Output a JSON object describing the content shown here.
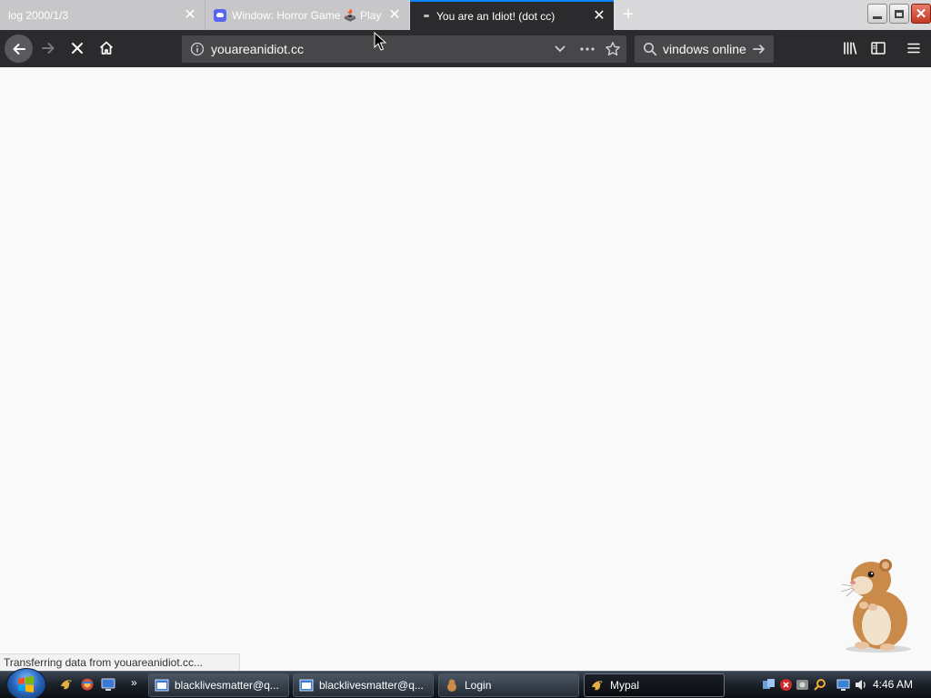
{
  "tabs": [
    {
      "title": "log 2000/1/3",
      "active": false
    },
    {
      "title": "Window: Horror Game 🕹️ Play",
      "active": false
    },
    {
      "title": "You are an Idiot! (dot cc)",
      "active": true
    }
  ],
  "toolbar": {
    "url": "youareanidiot.cc",
    "search_query": "vindows online"
  },
  "status_text": "Transferring data from youareanidiot.cc...",
  "taskbar": {
    "tasks": [
      {
        "label": "blacklivesmatter@q...",
        "active": false
      },
      {
        "label": "blacklivesmatter@q...",
        "active": false
      },
      {
        "label": "Login",
        "active": false
      },
      {
        "label": "Mypal",
        "active": true
      }
    ],
    "clock": "4:46 AM"
  },
  "colors": {
    "accent": "#0a84ff",
    "toolbar_dark": "#2b2b2e",
    "content_bg": "#f9f9fa"
  }
}
